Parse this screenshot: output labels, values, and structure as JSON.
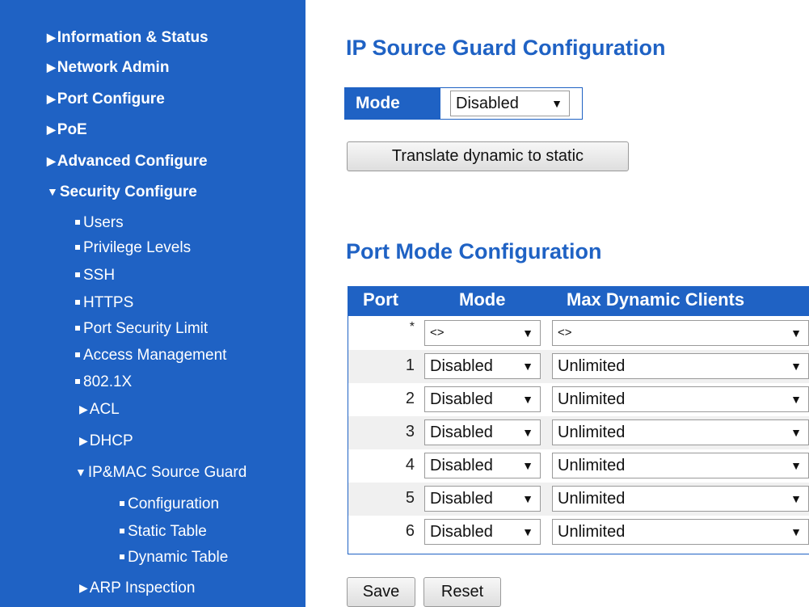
{
  "sidebar": {
    "items": [
      {
        "label": "Information & Status",
        "icon": "arrow-right-icon"
      },
      {
        "label": "Network Admin",
        "icon": "arrow-right-icon"
      },
      {
        "label": "Port Configure",
        "icon": "arrow-right-icon"
      },
      {
        "label": "PoE",
        "icon": "arrow-right-icon"
      },
      {
        "label": "Advanced Configure",
        "icon": "arrow-right-icon"
      },
      {
        "label": "Security Configure",
        "icon": "arrow-down-icon"
      }
    ],
    "security_items": [
      {
        "label": "Users"
      },
      {
        "label": "Privilege Levels"
      },
      {
        "label": "SSH"
      },
      {
        "label": "HTTPS"
      },
      {
        "label": "Port Security Limit"
      },
      {
        "label": "Access Management"
      },
      {
        "label": "802.1X"
      },
      {
        "label": "ACL"
      },
      {
        "label": "DHCP"
      },
      {
        "label": "IP&MAC Source Guard"
      },
      {
        "label": "ARP Inspection"
      }
    ],
    "source_guard_items": [
      {
        "label": "Configuration"
      },
      {
        "label": "Static Table"
      },
      {
        "label": "Dynamic Table"
      }
    ]
  },
  "main": {
    "title": "IP Source Guard Configuration",
    "mode_label": "Mode",
    "mode_value": "Disabled",
    "translate_button": "Translate dynamic to static",
    "port_section_title": "Port Mode Configuration",
    "table": {
      "headers": [
        "Port",
        "Mode",
        "Max Dynamic Clients"
      ],
      "rows": [
        {
          "port": "*",
          "mode": "<>",
          "max": "<>"
        },
        {
          "port": "1",
          "mode": "Disabled",
          "max": "Unlimited"
        },
        {
          "port": "2",
          "mode": "Disabled",
          "max": "Unlimited"
        },
        {
          "port": "3",
          "mode": "Disabled",
          "max": "Unlimited"
        },
        {
          "port": "4",
          "mode": "Disabled",
          "max": "Unlimited"
        },
        {
          "port": "5",
          "mode": "Disabled",
          "max": "Unlimited"
        },
        {
          "port": "6",
          "mode": "Disabled",
          "max": "Unlimited"
        }
      ]
    },
    "save_button": "Save",
    "reset_button": "Reset"
  },
  "colors": {
    "brand": "#1f62c4",
    "background": "#ffffff"
  }
}
